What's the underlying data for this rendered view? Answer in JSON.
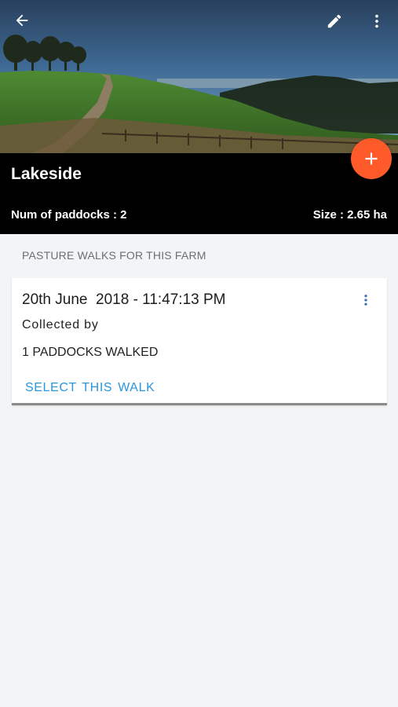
{
  "header": {
    "farm_name": "Lakeside",
    "paddocks": "Num of paddocks : 2",
    "size": "Size : 2.65 ha"
  },
  "icons": {
    "back": "arrow-back-icon",
    "edit": "pencil-icon",
    "more": "more-vert-icon",
    "fab": "plus-icon",
    "card_menu": "more-vert-icon"
  },
  "section": {
    "title": "PASTURE WALKS FOR THIS FARM"
  },
  "walks": [
    {
      "date": "20th June  2018 - 11:47:13 PM",
      "collected_by": "Collected by",
      "paddocks_walked": "1 PADDOCKS WALKED",
      "action": "SELECT THIS WALK"
    }
  ],
  "colors": {
    "accent_fab": "#ff5a2a",
    "link": "#2a95e0",
    "header_bg": "#000000",
    "page_bg": "#f3f4f6"
  }
}
